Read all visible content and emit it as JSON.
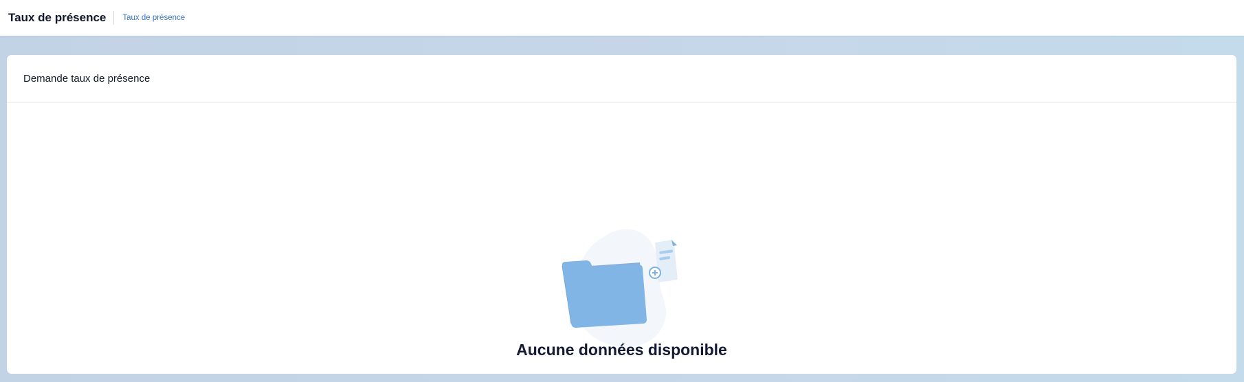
{
  "header": {
    "title": "Taux de présence",
    "breadcrumb": "Taux de présence"
  },
  "card": {
    "title": "Demande taux de présence"
  },
  "empty_state": {
    "message": "Aucune données disponible",
    "icon": "empty-folder-illustration"
  },
  "colors": {
    "accent": "#3b78c8",
    "folder": "#80b5e6",
    "background": "#c6d7e9"
  }
}
